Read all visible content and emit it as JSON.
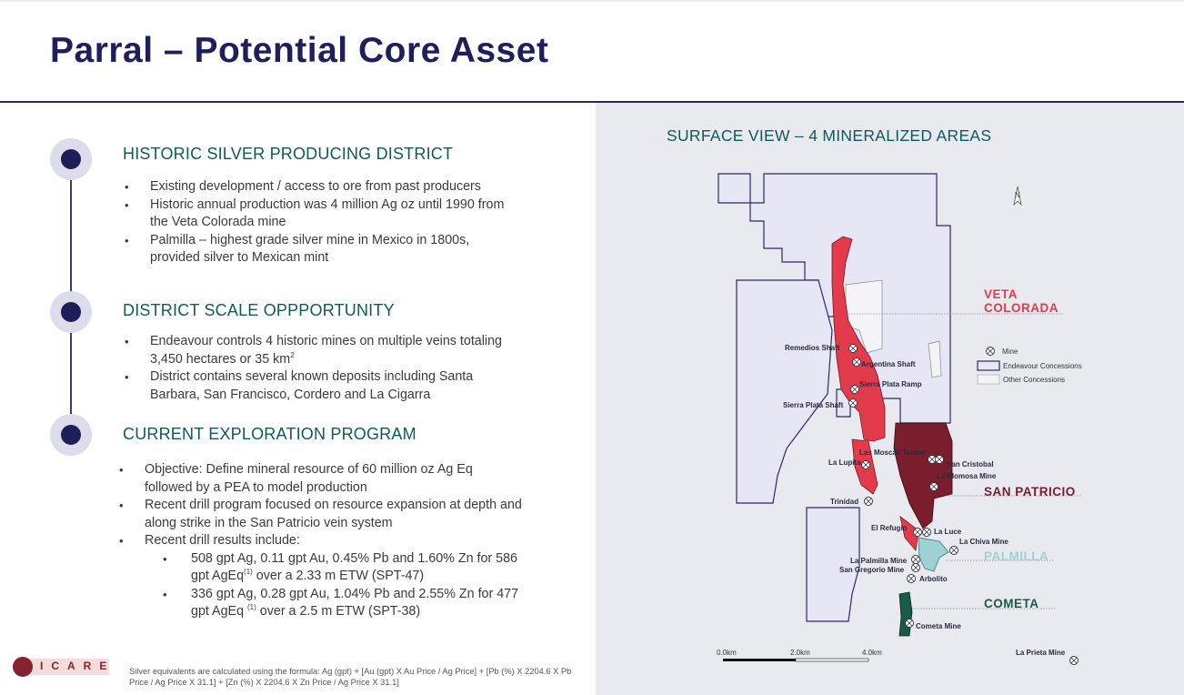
{
  "title": "Parral – Potential Core Asset",
  "sections": [
    {
      "heading": "HISTORIC SILVER PRODUCING DISTRICT",
      "bullets": [
        "Existing development / access to ore from past producers",
        "Historic annual production was 4 million Ag oz until 1990 from the Veta Colorada mine",
        "Palmilla – highest grade silver mine in Mexico in 1800s, provided silver to Mexican mint"
      ]
    },
    {
      "heading": "DISTRICT SCALE OPPPORTUNITY",
      "bullets": [
        "Endeavour controls 4 historic mines on multiple veins totaling 3,450 hectares or 35 km",
        "District contains several known deposits including Santa Barbara, San Francisco, Cordero and La Cigarra"
      ],
      "sup_2": "2"
    },
    {
      "heading": "CURRENT EXPLORATION PROGRAM",
      "bullets": [
        "Objective: Define mineral resource of 60 million oz Ag Eq followed by a PEA to model production",
        "Recent drill program focused on resource expansion at depth and along strike in the San Patricio vein system",
        "Recent drill results include:"
      ],
      "sub_bullets": [
        {
          "pre": "508 gpt Ag, 0.11 gpt Au, 0.45% Pb and 1.60% Zn for 586 gpt AgEq",
          "sup": "(1)",
          "post": " over a 2.33 m ETW (SPT-47)"
        },
        {
          "pre": "336 gpt Ag, 0.28 gpt Au, 1.04% Pb and 2.55% Zn for 477 gpt AgEq ",
          "sup": "(1)",
          "post": " over a 2.5 m ETW (SPT-38)"
        }
      ]
    }
  ],
  "footnote": "Silver equivalents are calculated using the formula: Ag (gpt) + [Au (gpt) X Au Price / Ag Price] + [Pb (%) X 2204.6 X Pb Price / Ag Price X 31.1] + [Zn (%) X 2204.6 X Zn Price / Ag Price X 31.1]",
  "logo_text": "ICARE",
  "map": {
    "title": "SURFACE VIEW – 4 MINERALIZED AREAS",
    "north": "N",
    "areas": {
      "veta_1": "VETA",
      "veta_2": "COLORADA",
      "san_patricio": "SAN PATRICIO",
      "palmilla": "PALMILLA",
      "cometa": "COMETA"
    },
    "colors": {
      "veta": "#e23c4c",
      "san_patricio": "#7a1e2e",
      "palmilla": "#9fd0d4",
      "cometa": "#1a5a48",
      "endeavour_fill": "#e6e6f5",
      "endeavour_stroke": "#2a2a6a"
    },
    "legend": {
      "mine": "Mine",
      "endeavour": "Endeavour Concessions",
      "other": "Other Concessions"
    },
    "mines": {
      "remedios": "Remedios Shaft",
      "argentina": "Argentina Shaft",
      "sierra_ramp": "Sierra Plata Ramp",
      "sierra_shaft": "Sierra Plata Shaft",
      "mosca": "Las Moscas Tunnel",
      "cristobal": "San Cristobal",
      "lupita": "La Lupita",
      "plomosa": "La Plomosa Mine",
      "trinidad": "Trinidad",
      "refugio": "El Refugio",
      "luce": "La Luce",
      "chiva": "La Chiva Mine",
      "palmilla_mine": "La Palmilla Mine",
      "gregorio": "San Gregorio Mine",
      "arbolito": "Arbolito",
      "cometa_mine": "Cometa Mine",
      "prieta": "La Prieta Mine"
    },
    "scale": [
      "0.0km",
      "2.0km",
      "4.0km"
    ]
  }
}
